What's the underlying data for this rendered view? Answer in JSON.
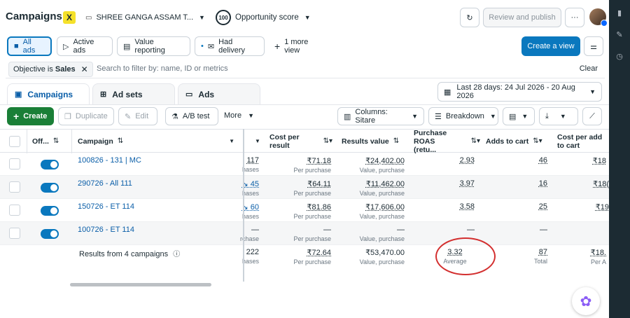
{
  "header": {
    "title": "Campaigns",
    "account_name": "SHREE GANGA ASSAM T...",
    "account_logo_text": "X",
    "opportunity_score_value": "100",
    "opportunity_score_label": "Opportunity score",
    "review_publish": "Review and publish",
    "more_label": "···"
  },
  "views": {
    "all_ads": "All ads",
    "active_ads": "Active ads",
    "value_reporting": "Value reporting",
    "had_delivery": "Had delivery",
    "more_view": "1 more view",
    "create_view": "Create a view"
  },
  "filter": {
    "chip_prefix": "Objective is",
    "chip_value": "Sales",
    "placeholder": "Search to filter by: name, ID or metrics",
    "clear": "Clear"
  },
  "tabs": [
    "Campaigns",
    "Ad sets",
    "Ads"
  ],
  "date_range": "Last 28 days: 24 Jul 2026 - 20 Aug 2026",
  "toolbar": {
    "create": "Create",
    "duplicate": "Duplicate",
    "edit": "Edit",
    "ab_test": "A/B test",
    "more": "More",
    "columns": "Columns: Sitare",
    "breakdown": "Breakdown"
  },
  "table": {
    "headers": {
      "off_on": "Off...",
      "campaign": "Campaign",
      "cost_per_result": "Cost per result",
      "results_value": "Results value",
      "purchase_roas": "Purchase ROAS (retu...",
      "adds_to_cart": "Adds to cart",
      "cost_per_add": "Cost per add to cart"
    },
    "rows": [
      {
        "campaign": "100826 - 131 | MC",
        "results": "117",
        "results_sub": "hases",
        "cpr": "₹71.18",
        "cpr_sub": "Per purchase",
        "value": "₹24,402.00",
        "value_sub": "Value, purchase",
        "roas": "2.93",
        "atc": "46",
        "cpa": "₹18"
      },
      {
        "campaign": "290726 - All 111",
        "results": "↘ 45",
        "results_sub": "hases",
        "cpr": "₹64.11",
        "cpr_sub": "Per purchase",
        "value": "₹11,462.00",
        "value_sub": "Value, purchase",
        "roas": "3.97",
        "atc": "16",
        "cpa": "₹18("
      },
      {
        "campaign": "150726 - ET 114",
        "results": "↘ 60",
        "results_sub": "hases",
        "cpr": "₹81.86",
        "cpr_sub": "Per purchase",
        "value": "₹17,606.00",
        "value_sub": "Value, purchase",
        "roas": "3.58",
        "atc": "25",
        "cpa": "₹19"
      },
      {
        "campaign": "100726 - ET 114",
        "results": "—",
        "results_sub": "rchase",
        "cpr": "—",
        "cpr_sub": "Per purchase",
        "value": "—",
        "value_sub": "Value, purchase",
        "roas": "—",
        "atc": "—",
        "cpa": ""
      }
    ],
    "summary": {
      "label": "Results from 4 campaigns",
      "results": "222",
      "results_sub": "hases",
      "cpr": "₹72.64",
      "cpr_sub": "Per purchase",
      "value": "₹53,470.00",
      "value_sub": "Value, purchase",
      "roas": "3.32",
      "roas_sub": "Average",
      "atc": "87",
      "atc_sub": "Total",
      "cpa": "₹18.",
      "cpa_sub": "Per A"
    }
  },
  "colors": {
    "accent": "#0a78be",
    "create_green": "#1a7f37",
    "highlight_circle": "#d32f2f",
    "rail": "#1c2b33"
  }
}
